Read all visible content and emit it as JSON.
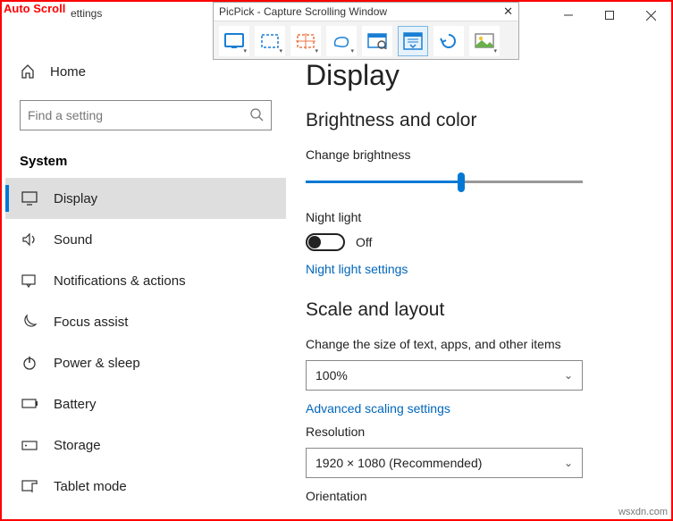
{
  "overlay": {
    "auto_scroll": "Auto Scroll"
  },
  "window": {
    "app_title_visible": "ettings"
  },
  "picpick": {
    "title": "PicPick - Capture Scrolling Window",
    "tools": {
      "full": "fullscreen-icon",
      "region": "region-icon",
      "fixed": "fixed-region-icon",
      "freehand": "freehand-icon",
      "window": "window-icon",
      "scroll": "scrolling-window-icon",
      "repeat": "repeat-icon",
      "image": "image-icon"
    }
  },
  "sidebar": {
    "home_label": "Home",
    "search_placeholder": "Find a setting",
    "section": "System",
    "items": [
      {
        "label": "Display"
      },
      {
        "label": "Sound"
      },
      {
        "label": "Notifications & actions"
      },
      {
        "label": "Focus assist"
      },
      {
        "label": "Power & sleep"
      },
      {
        "label": "Battery"
      },
      {
        "label": "Storage"
      },
      {
        "label": "Tablet mode"
      }
    ],
    "selected_index": 0
  },
  "main": {
    "title": "Display",
    "brightness_section": "Brightness and color",
    "brightness_label": "Change brightness",
    "brightness_percent": 56,
    "nightlight_label": "Night light",
    "nightlight_state": "Off",
    "nightlight_link": "Night light settings",
    "scale_section": "Scale and layout",
    "scale_label": "Change the size of text, apps, and other items",
    "scale_value": "100%",
    "advanced_link": "Advanced scaling settings",
    "resolution_label": "Resolution",
    "resolution_value": "1920 × 1080 (Recommended)",
    "orientation_label": "Orientation"
  },
  "watermark": "wsxdn.com"
}
